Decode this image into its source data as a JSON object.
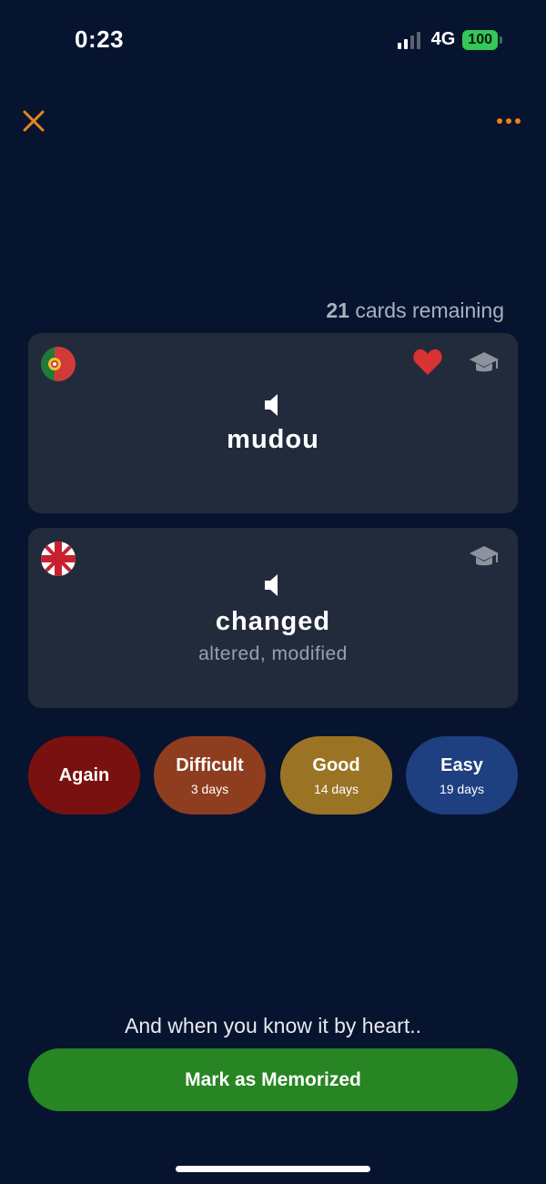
{
  "status_bar": {
    "time": "0:23",
    "network": "4G",
    "battery": "100",
    "signal_icon": "cellular-signal-icon",
    "battery_color": "#34c759"
  },
  "nav": {
    "close_icon": "close-icon",
    "more_icon": "more-dots-icon",
    "accent_color": "#e8841c"
  },
  "progress": {
    "count": "21",
    "suffix": " cards remaining"
  },
  "front_card": {
    "flag_icon": "portugal-flag-icon",
    "word": "mudou",
    "favorite_icon": "heart-icon",
    "favorite_color": "#d83232",
    "learn_icon": "graduation-cap-icon",
    "speaker_icon": "speaker-icon"
  },
  "back_card": {
    "flag_icon": "uk-flag-icon",
    "word": "changed",
    "synonyms": "altered, modified",
    "learn_icon": "graduation-cap-icon",
    "speaker_icon": "speaker-icon"
  },
  "answers": [
    {
      "label": "Again",
      "interval": "",
      "color": "#7a1111"
    },
    {
      "label": "Difficult",
      "interval": "3 days",
      "color": "#8e3e1f"
    },
    {
      "label": "Good",
      "interval": "14 days",
      "color": "#9a7424"
    },
    {
      "label": "Easy",
      "interval": "19 days",
      "color": "#1e3f80"
    }
  ],
  "footer": {
    "hint": "And when you know it by heart..",
    "memorize_label": "Mark as Memorized",
    "memorize_color": "#278523"
  }
}
